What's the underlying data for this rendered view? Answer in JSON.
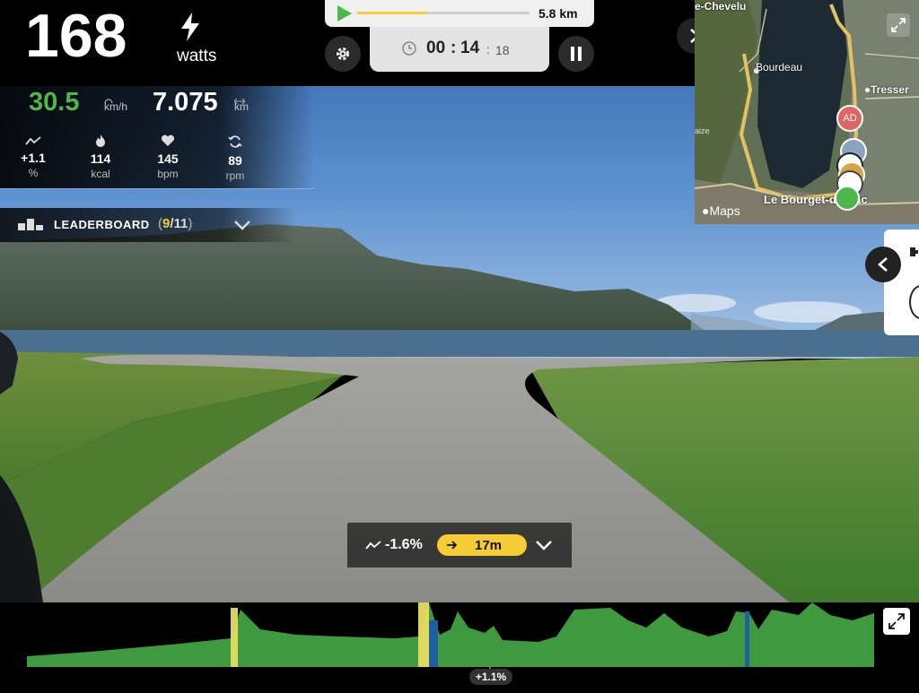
{
  "power": {
    "value": "168",
    "unit": "watts"
  },
  "route_progress": {
    "distance": "5.8 km",
    "fraction": 0.4
  },
  "timer": {
    "hours": "00",
    "minutes": "14",
    "seconds": "18",
    "sep1": ":",
    "sep2": ":"
  },
  "speed": {
    "value": "30.5",
    "unit": "km/h"
  },
  "distance": {
    "value": "7.075",
    "unit": "km"
  },
  "stats": [
    {
      "value": "+1.1",
      "unit": "%",
      "icon": "slope-icon"
    },
    {
      "value": "114",
      "unit": "kcal",
      "icon": "flame-icon"
    },
    {
      "value": "145",
      "unit": "bpm",
      "icon": "heart-icon"
    },
    {
      "value": "89",
      "unit": "rpm",
      "icon": "cadence-icon"
    }
  ],
  "leaderboard": {
    "label": "LEADERBOARD",
    "open": "(",
    "position": "9",
    "slash": "/11",
    "close": ")"
  },
  "map": {
    "labels": [
      "e-Chevelu",
      "Bourdeau",
      "Tresser",
      "Le Bourget-du-Lac",
      "aize"
    ],
    "avatar_initials": "AD",
    "attribution": "Maps"
  },
  "slope_pill": {
    "grade": "-1.6%",
    "distance": "17m"
  },
  "elevation": {
    "current_grade": "+1.1%"
  },
  "colors": {
    "accent_green": "#4cb84a",
    "accent_yellow": "#f5cc33",
    "profile_green": "#3f9a3f",
    "route_yellow": "#e8c553"
  }
}
